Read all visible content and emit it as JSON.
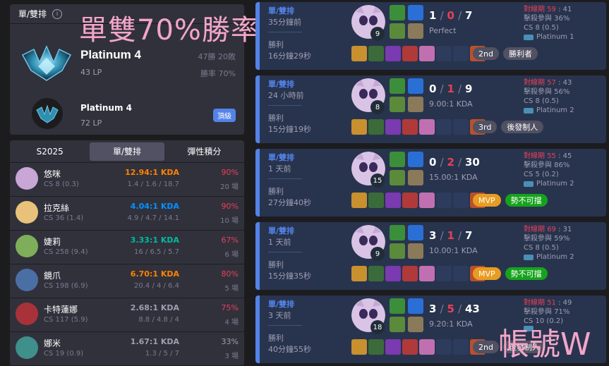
{
  "rank": {
    "queue_label": "單/雙排",
    "tier": "Platinum 4",
    "lp": "43 LP",
    "win_loss": "47勝 20敗",
    "win_rate": "勝率 70%",
    "peak_tier": "Platinum 4",
    "peak_lp": "72 LP",
    "peak_badge": "頂級"
  },
  "overlay": {
    "title": "單雙70%勝率",
    "corner": "帳號W"
  },
  "champ_tabs": [
    "S2025",
    "單/雙排",
    "彈性積分"
  ],
  "champions": [
    {
      "name": "悠咪",
      "cs": "CS 8 (0.3)",
      "kda": "12.94:1 KDA",
      "kda_detail": "1.4 / 1.6 / 18.7",
      "wr": "90%",
      "games": "20 場",
      "kda_color": "#ff8200",
      "wr_color": "#e84057",
      "icon_color": "#c8a6d6"
    },
    {
      "name": "拉克絲",
      "cs": "CS 36 (1.4)",
      "kda": "4.04:1 KDA",
      "kda_detail": "4.9 / 4.7 / 14.1",
      "wr": "90%",
      "games": "10 場",
      "kda_color": "#0093ff",
      "wr_color": "#e84057",
      "icon_color": "#e8c27a"
    },
    {
      "name": "婕莉",
      "cs": "CS 258 (9.4)",
      "kda": "3.33:1 KDA",
      "kda_detail": "16 / 6.5 / 5.7",
      "wr": "67%",
      "games": "6 場",
      "kda_color": "#00bba3",
      "wr_color": "#e84057",
      "icon_color": "#7fae5a"
    },
    {
      "name": "鏡爪",
      "cs": "CS 198 (6.9)",
      "kda": "6.70:1 KDA",
      "kda_detail": "20.4 / 4 / 6.4",
      "wr": "80%",
      "games": "5 場",
      "kda_color": "#ff8200",
      "wr_color": "#e84057",
      "icon_color": "#4a6fa5"
    },
    {
      "name": "卡特蓮娜",
      "cs": "CS 117 (5.9)",
      "kda": "2.68:1 KDA",
      "kda_detail": "8.8 / 4.8 / 4",
      "wr": "75%",
      "games": "4 場",
      "kda_color": "#9e9eb1",
      "wr_color": "#e84057",
      "icon_color": "#a8323a"
    },
    {
      "name": "娜米",
      "cs": "CS 19 (0.9)",
      "kda": "1.67:1 KDA",
      "kda_detail": "1.3 / 5 / 7",
      "wr": "33%",
      "games": "3 場",
      "kda_color": "#9e9eb1",
      "wr_color": "#9e9eb1",
      "icon_color": "#3f8f8a"
    }
  ],
  "matches": [
    {
      "type": "單/雙排",
      "time": "35分鐘前",
      "result": "勝利",
      "duration": "16分鐘29秒",
      "level": "9",
      "kills": "1",
      "deaths": "0",
      "assists": "7",
      "kda_ratio": "Perfect",
      "badges": [
        {
          "label": "2nd",
          "kind": "gray"
        },
        {
          "label": "勝利者",
          "kind": "gray"
        }
      ],
      "pk_label": "對線期",
      "pk_score": "59",
      "pk_opp": "41",
      "kp": "擊殺參與 36%",
      "cs": "CS 8 (0.5)",
      "tier": "Platinum 1"
    },
    {
      "type": "單/雙排",
      "time": "24 小時前",
      "result": "勝利",
      "duration": "15分鐘19秒",
      "level": "8",
      "kills": "0",
      "deaths": "1",
      "assists": "9",
      "kda_ratio": "9.00:1 KDA",
      "badges": [
        {
          "label": "3rd",
          "kind": "gray"
        },
        {
          "label": "後發制人",
          "kind": "gray"
        }
      ],
      "pk_label": "對線期",
      "pk_score": "57",
      "pk_opp": "43",
      "kp": "擊殺參與 56%",
      "cs": "CS 8 (0.5)",
      "tier": "Platinum 2"
    },
    {
      "type": "單/雙排",
      "time": "1 天前",
      "result": "勝利",
      "duration": "27分鐘40秒",
      "level": "15",
      "kills": "0",
      "deaths": "2",
      "assists": "30",
      "kda_ratio": "15.00:1 KDA",
      "badges": [
        {
          "label": "MVP",
          "kind": "mvp"
        },
        {
          "label": "勢不可擋",
          "kind": "green"
        }
      ],
      "pk_label": "對線期",
      "pk_score": "55",
      "pk_opp": "45",
      "kp": "擊殺參與 86%",
      "cs": "CS 5 (0.2)",
      "tier": "Platinum 2"
    },
    {
      "type": "單/雙排",
      "time": "1 天前",
      "result": "勝利",
      "duration": "15分鐘35秒",
      "level": "9",
      "kills": "3",
      "deaths": "1",
      "assists": "7",
      "kda_ratio": "10.00:1 KDA",
      "badges": [
        {
          "label": "MVP",
          "kind": "mvp"
        },
        {
          "label": "勢不可擋",
          "kind": "green"
        }
      ],
      "pk_label": "對線期",
      "pk_score": "69",
      "pk_opp": "31",
      "kp": "擊殺參與 59%",
      "cs": "CS 8 (0.5)",
      "tier": "Platinum 2"
    },
    {
      "type": "單/雙排",
      "time": "3 天前",
      "result": "勝利",
      "duration": "40分鐘55秒",
      "level": "18",
      "kills": "3",
      "deaths": "5",
      "assists": "43",
      "kda_ratio": "9.20:1 KDA",
      "badges": [
        {
          "label": "2nd",
          "kind": "gray"
        },
        {
          "label": "後發制人",
          "kind": "gray"
        }
      ],
      "pk_label": "對線期",
      "pk_score": "51",
      "pk_opp": "49",
      "kp": "擊殺參與 71%",
      "cs": "CS 10 (0.2)",
      "tier": ""
    }
  ],
  "colors": {
    "accent": "#5383e8",
    "win_bg": "#28344e",
    "panel": "#31313c",
    "overlay_pink": "#f3a6c7"
  }
}
